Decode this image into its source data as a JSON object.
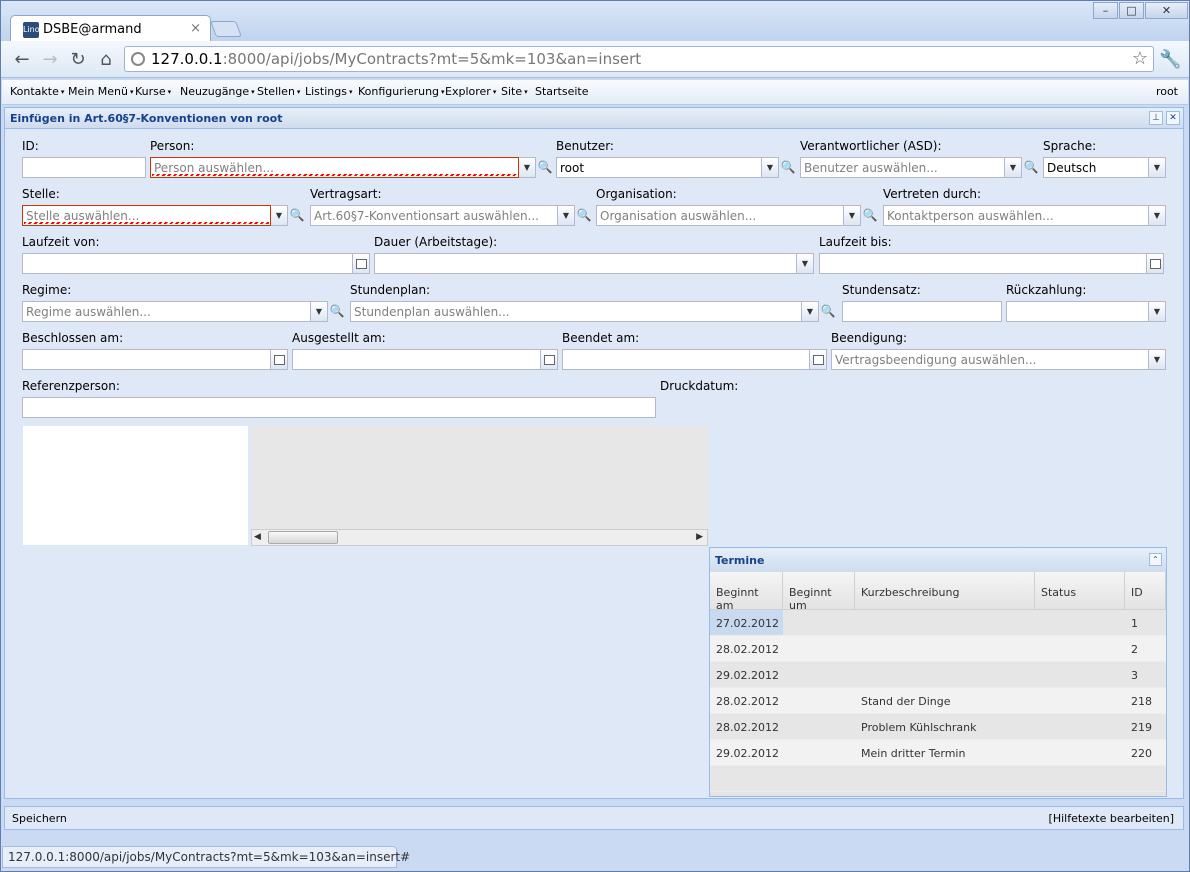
{
  "tab": {
    "title": "DSBE@armand",
    "favicon": "Lino"
  },
  "url": {
    "host": "127.0.0.1",
    "rest": ":8000/api/jobs/MyContracts?mt=5&mk=103&an=insert"
  },
  "menu": {
    "items": [
      "Kontakte",
      "Mein Menü",
      "Kurse",
      "Neuzugänge",
      "Stellen",
      "Listings",
      "Konfigurierung",
      "Explorer",
      "Site",
      "Startseite"
    ],
    "user": "root"
  },
  "panel": {
    "title": "Einfügen in Art.60§7-Konventionen von root"
  },
  "form": {
    "id": {
      "label": "ID:",
      "value": ""
    },
    "person": {
      "label": "Person:",
      "placeholder": "Person auswählen..."
    },
    "benutzer": {
      "label": "Benutzer:",
      "value": "root"
    },
    "asd": {
      "label": "Verantwortlicher (ASD):",
      "placeholder": "Benutzer auswählen..."
    },
    "sprache": {
      "label": "Sprache:",
      "value": "Deutsch"
    },
    "stelle": {
      "label": "Stelle:",
      "placeholder": "Stelle auswählen..."
    },
    "vertragsart": {
      "label": "Vertragsart:",
      "placeholder": "Art.60§7-Konventionsart auswählen..."
    },
    "organisation": {
      "label": "Organisation:",
      "placeholder": "Organisation auswählen..."
    },
    "vertreten": {
      "label": "Vertreten durch:",
      "placeholder": "Kontaktperson auswählen..."
    },
    "laufzeit_von": {
      "label": "Laufzeit von:"
    },
    "dauer": {
      "label": "Dauer (Arbeitstage):"
    },
    "laufzeit_bis": {
      "label": "Laufzeit bis:"
    },
    "regime": {
      "label": "Regime:",
      "placeholder": "Regime auswählen..."
    },
    "stundenplan": {
      "label": "Stundenplan:",
      "placeholder": "Stundenplan auswählen..."
    },
    "stundensatz": {
      "label": "Stundensatz:"
    },
    "rueckzahlung": {
      "label": "Rückzahlung:"
    },
    "beschlossen": {
      "label": "Beschlossen am:"
    },
    "ausgestellt": {
      "label": "Ausgestellt am:"
    },
    "beendet": {
      "label": "Beendet am:"
    },
    "beendigung": {
      "label": "Beendigung:",
      "placeholder": "Vertragsbeendigung auswählen..."
    },
    "referenzperson": {
      "label": "Referenzperson:"
    },
    "druckdatum": {
      "label": "Druckdatum:"
    }
  },
  "termine": {
    "title": "Termine",
    "columns": [
      "Beginnt am",
      "Beginnt um",
      "Kurzbeschreibung",
      "Status",
      "ID"
    ],
    "rows": [
      [
        "27.02.2012",
        "",
        "",
        "",
        "1"
      ],
      [
        "28.02.2012",
        "",
        "",
        "",
        "2"
      ],
      [
        "29.02.2012",
        "",
        "",
        "",
        "3"
      ],
      [
        "28.02.2012",
        "",
        "Stand der Dinge",
        "",
        "218"
      ],
      [
        "28.02.2012",
        "",
        "Problem Kühlschrank",
        "",
        "219"
      ],
      [
        "29.02.2012",
        "",
        "Mein dritter Termin",
        "",
        "220"
      ]
    ]
  },
  "status": {
    "save": "Speichern",
    "help": "[Hilfetexte bearbeiten]"
  },
  "hover_url": "127.0.0.1:8000/api/jobs/MyContracts?mt=5&mk=103&an=insert#"
}
